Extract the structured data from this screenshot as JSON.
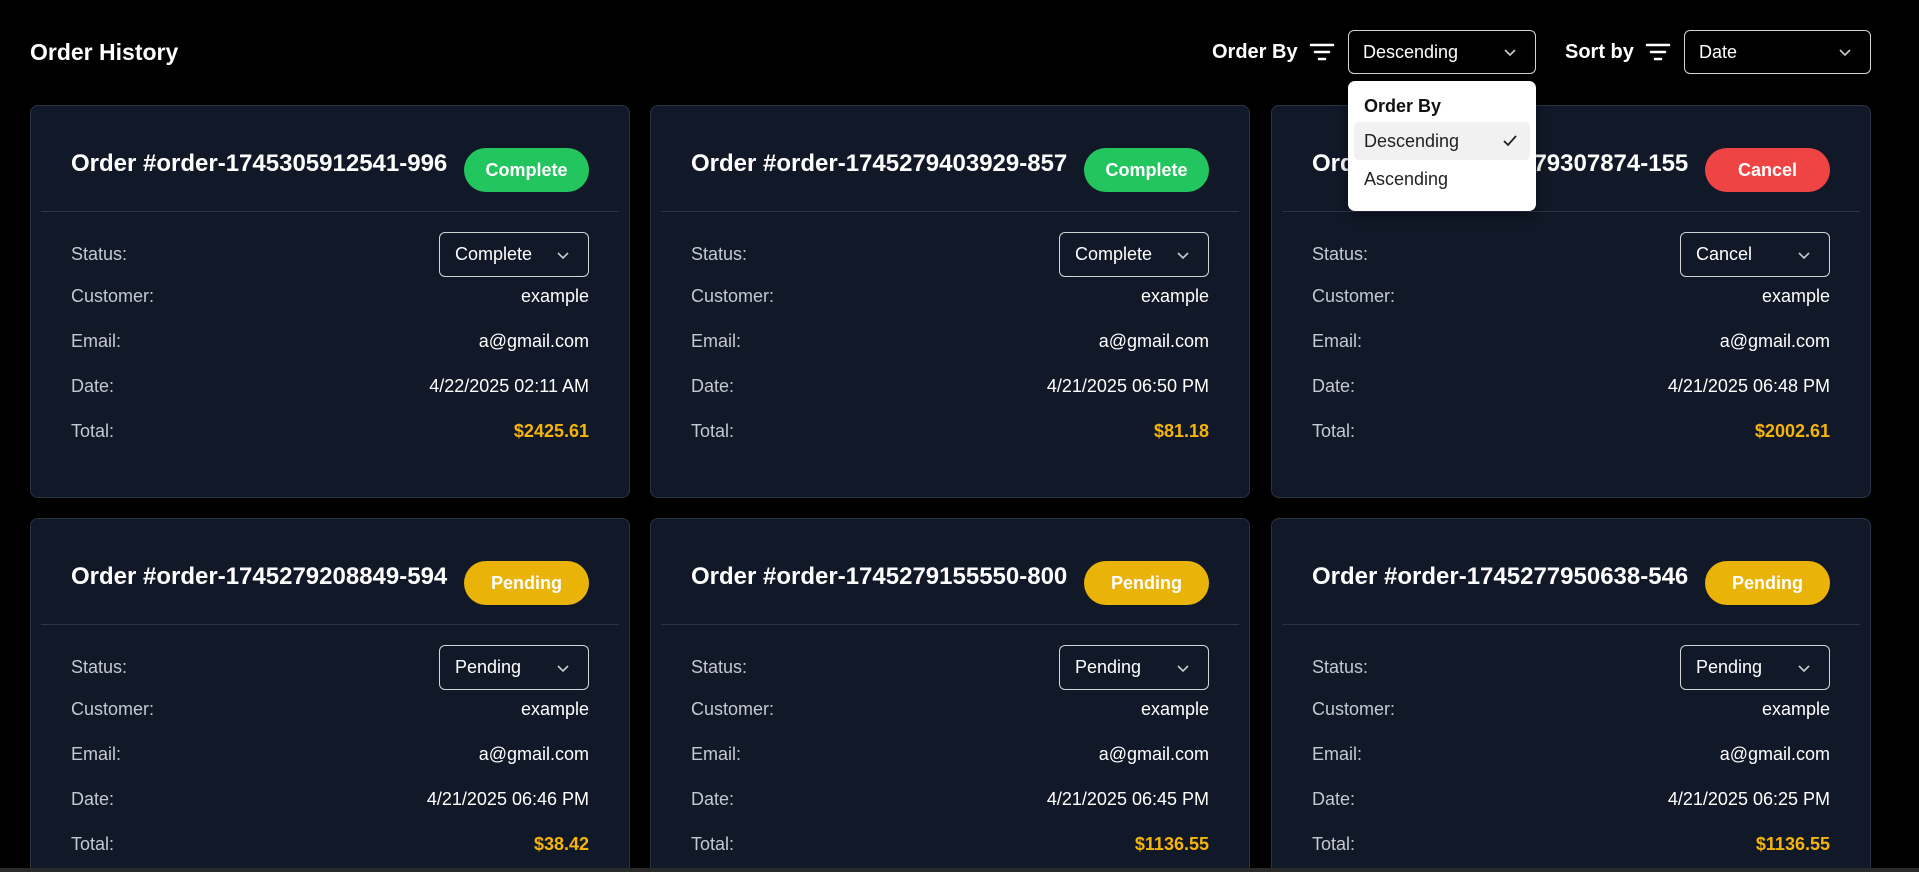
{
  "header": {
    "title": "Order History",
    "order_by_label": "Order By",
    "order_by_value": "Descending",
    "sort_by_label": "Sort by",
    "sort_by_value": "Date"
  },
  "dropdown": {
    "heading": "Order By",
    "options": [
      "Descending",
      "Ascending"
    ],
    "selected": "Descending"
  },
  "labels": {
    "status": "Status:",
    "customer": "Customer:",
    "email": "Email:",
    "date": "Date:",
    "total": "Total:"
  },
  "colors": {
    "complete": "#22c55e",
    "cancel": "#ef4444",
    "pending": "#eab308",
    "total": "#f5b40a"
  },
  "orders": [
    {
      "title": "Order #order-1745305912541-996",
      "badge": "Complete",
      "status": "Complete",
      "customer": "example",
      "email": "a@gmail.com",
      "date": "4/22/2025 02:11 AM",
      "total": "$2425.61"
    },
    {
      "title": "Order #order-1745279403929-857",
      "badge": "Complete",
      "status": "Complete",
      "customer": "example",
      "email": "a@gmail.com",
      "date": "4/21/2025 06:50 PM",
      "total": "$81.18"
    },
    {
      "title": "Order #order-1745279307874-155",
      "badge": "Cancel",
      "status": "Cancel",
      "customer": "example",
      "email": "a@gmail.com",
      "date": "4/21/2025 06:48 PM",
      "total": "$2002.61"
    },
    {
      "title": "Order #order-1745279208849-594",
      "badge": "Pending",
      "status": "Pending",
      "customer": "example",
      "email": "a@gmail.com",
      "date": "4/21/2025 06:46 PM",
      "total": "$38.42"
    },
    {
      "title": "Order #order-1745279155550-800",
      "badge": "Pending",
      "status": "Pending",
      "customer": "example",
      "email": "a@gmail.com",
      "date": "4/21/2025 06:45 PM",
      "total": "$1136.55"
    },
    {
      "title": "Order #order-1745277950638-546",
      "badge": "Pending",
      "status": "Pending",
      "customer": "example",
      "email": "a@gmail.com",
      "date": "4/21/2025 06:25 PM",
      "total": "$1136.55"
    }
  ]
}
